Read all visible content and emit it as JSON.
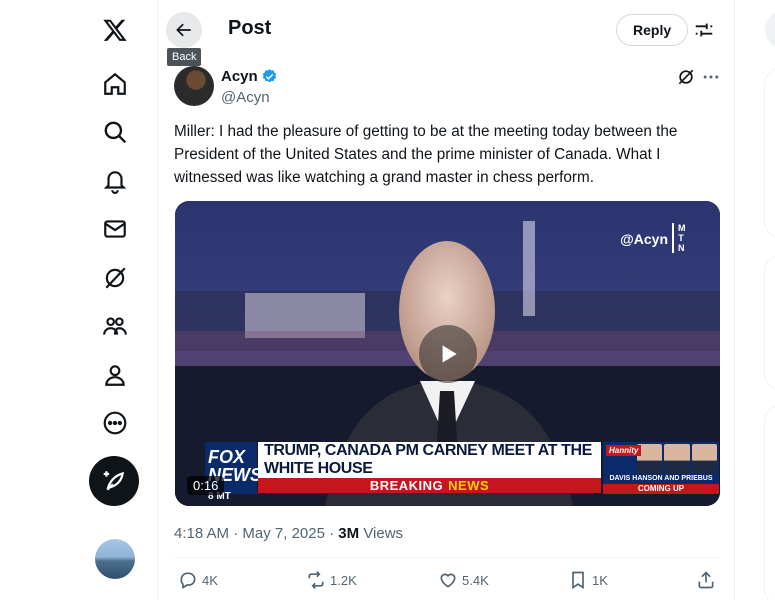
{
  "nav": {
    "items": [
      "x-logo",
      "home",
      "explore",
      "notifications",
      "messages",
      "grok",
      "communities",
      "profile",
      "more"
    ],
    "compose_label": "Post"
  },
  "header": {
    "title": "Post",
    "back_tooltip": "Back",
    "reply_label": "Reply"
  },
  "post": {
    "author_name": "Acyn",
    "author_handle": "@Acyn",
    "text": "Miller: I had the pleasure of getting to be at the meeting today between the President of the United States and the prime minister of Canada. What I witnessed was like watching a grand master in chess perform.",
    "video": {
      "watermark": "@Acyn",
      "watermark_sub": "M T N",
      "chyron_headline": "TRUMP, CANADA PM CARNEY MEET AT THE WHITE HOUSE",
      "breaking_label": "BREAKING",
      "breaking_news": "NEWS",
      "network": "FOX NEWS",
      "network_time": "8 MT",
      "promo_show": "Hannity",
      "promo_names": "DAVIS HANSON AND PRIEBUS",
      "promo_coming": "COMING UP",
      "duration": "0:16"
    },
    "time": "4:18 AM",
    "date": "May 7, 2025",
    "views_count": "3M",
    "views_label": "Views",
    "replies": "4K",
    "reposts": "1.2K",
    "likes": "5.4K",
    "bookmarks": "1K"
  },
  "colors": {
    "accent": "#1d9bf0",
    "text_primary": "#0f1419",
    "text_secondary": "#536471",
    "fox_blue": "#0b2a6a",
    "breaking_red": "#c4161c"
  }
}
